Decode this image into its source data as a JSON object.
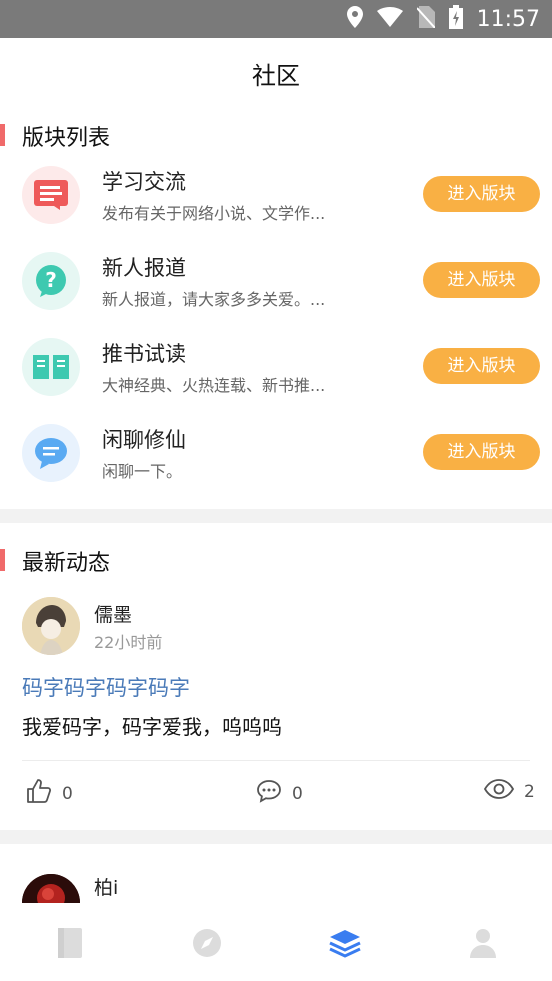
{
  "status_bar": {
    "time": "11:57"
  },
  "header": {
    "title": "社区"
  },
  "sections": {
    "boards_title": "版块列表",
    "feed_title": "最新动态"
  },
  "boards": [
    {
      "name": "学习交流",
      "desc": "发布有关于网络小说、文学作...",
      "button": "进入版块",
      "icon": "article-icon",
      "color": "#ee5a5a",
      "bg": "#fdeaea"
    },
    {
      "name": "新人报道",
      "desc": "新人报道，请大家多多关爱。...",
      "button": "进入版块",
      "icon": "question-icon",
      "color": "#3ec9b0",
      "bg": "#e6f7f3"
    },
    {
      "name": "推书试读",
      "desc": "大神经典、火热连载、新书推...",
      "button": "进入版块",
      "icon": "book-icon",
      "color": "#3ec9b0",
      "bg": "#e6f7f3"
    },
    {
      "name": "闲聊修仙",
      "desc": "闲聊一下。",
      "button": "进入版块",
      "icon": "chat-icon",
      "color": "#5aaaf2",
      "bg": "#e8f2fd"
    }
  ],
  "posts": [
    {
      "username": "儒墨",
      "time": "22小时前",
      "title": "码字码字码字码字",
      "body": "我爱码字，码字爱我，呜呜呜",
      "likes": "0",
      "comments": "0",
      "views": "2"
    },
    {
      "username": "柏i"
    }
  ],
  "bottom_nav": {
    "items": [
      "bookshelf-icon",
      "discover-icon",
      "community-icon",
      "profile-icon"
    ],
    "active_color": "#3a7df0",
    "inactive_color": "#dcdcdc"
  }
}
